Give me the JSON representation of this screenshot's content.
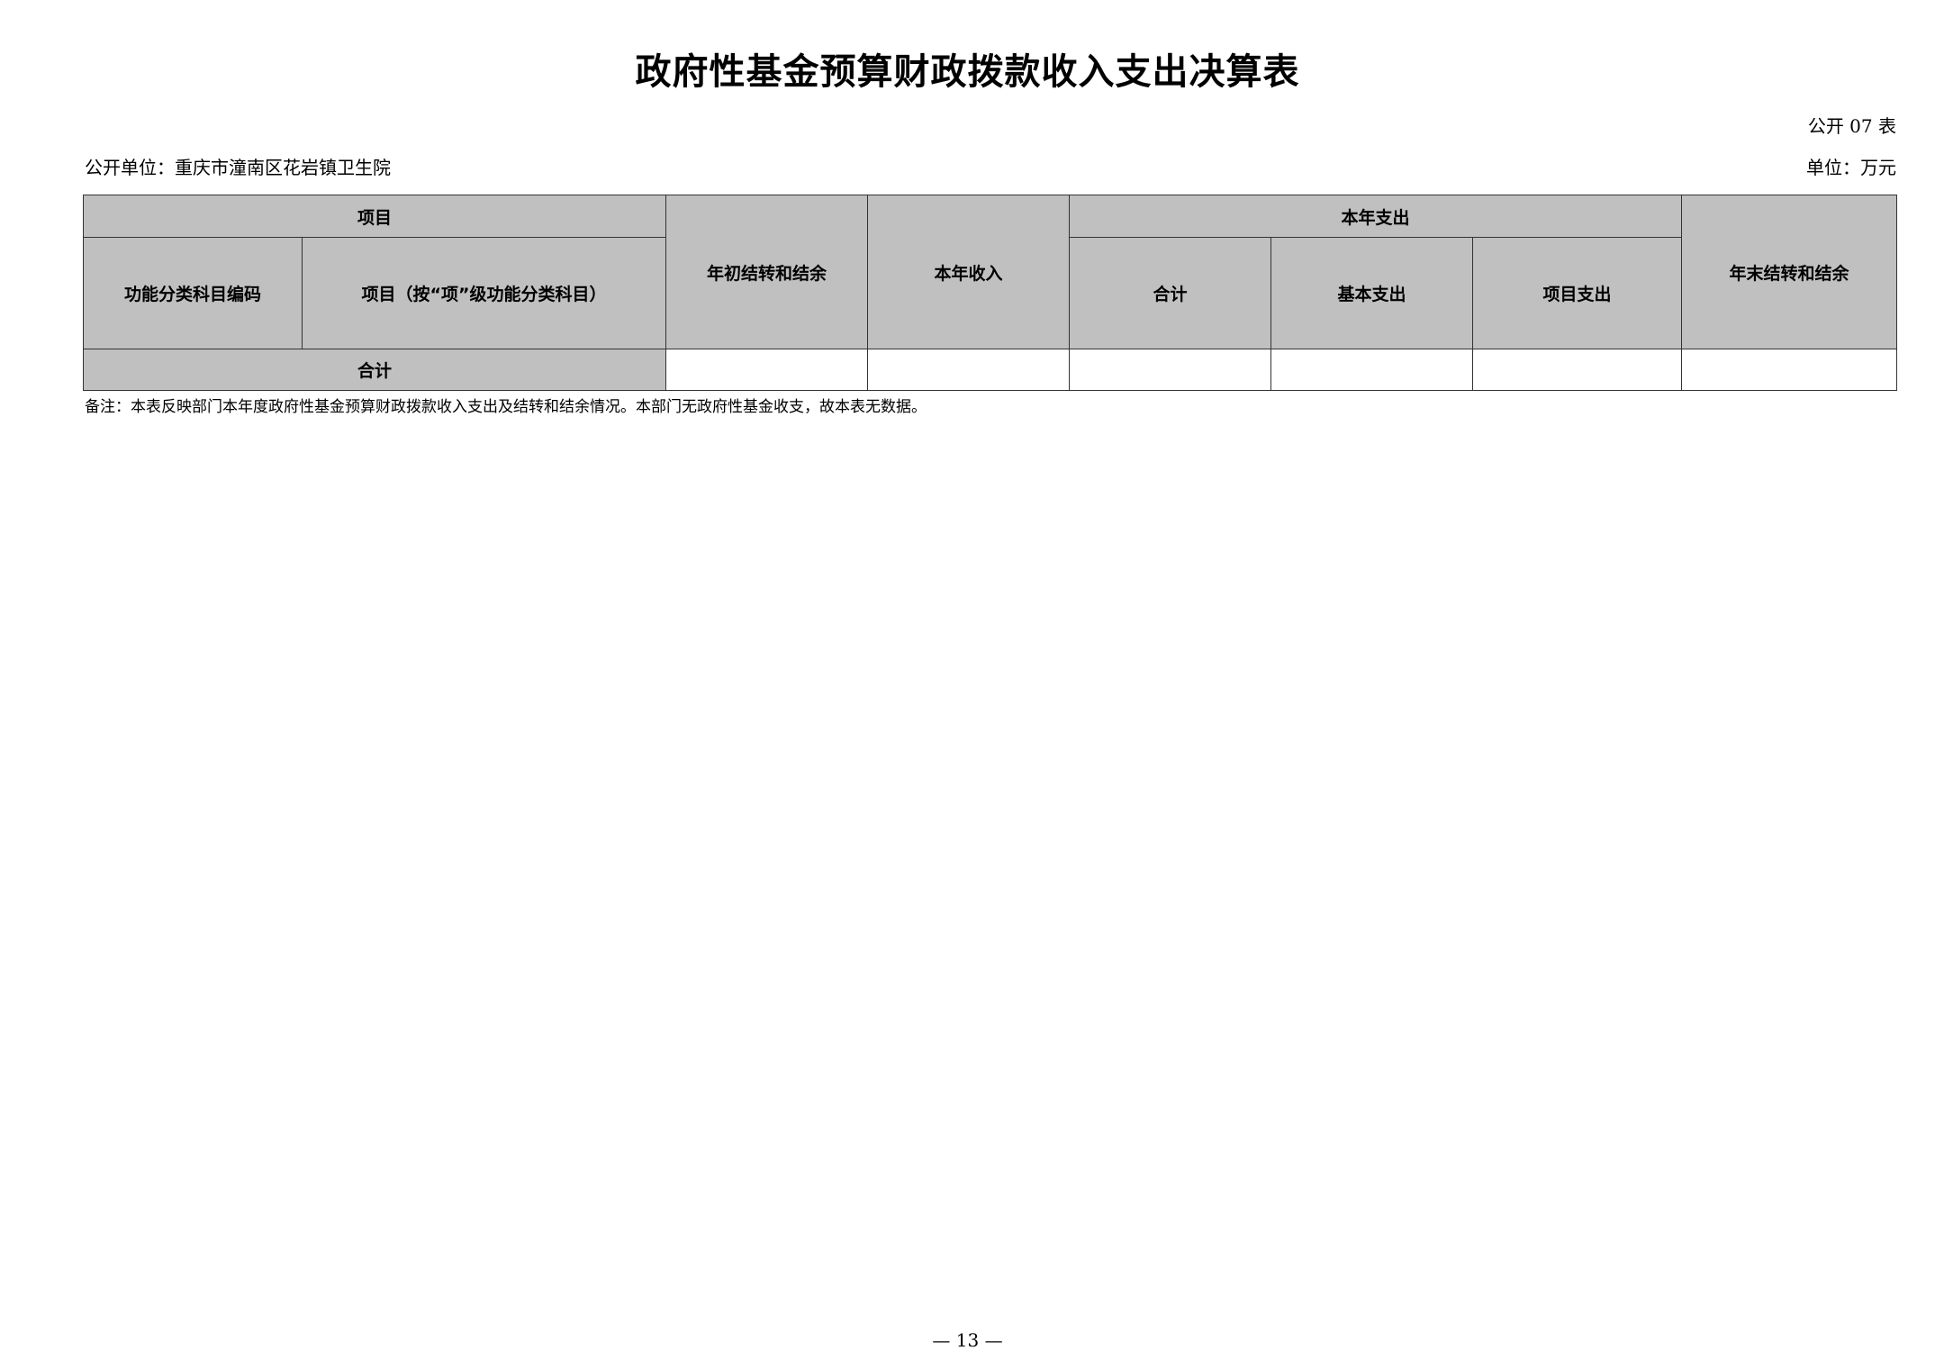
{
  "document": {
    "title": "政府性基金预算财政拨款收入支出决算表",
    "form_number": "公开 07 表",
    "reporting_unit": "公开单位：重庆市潼南区花岩镇卫生院",
    "currency_unit": "单位：万元",
    "note": "备注：本表反映部门本年度政府性基金预算财政拨款收入支出及结转和结余情况。本部门无政府性基金收支，故本表无数据。",
    "page_number": "— 13 —"
  },
  "table": {
    "headers": {
      "item": "项目",
      "function_code": "功能分类科目编码",
      "item_name": "项目（按“项”级功能分类科目）",
      "opening_balance": "年初结转和结余",
      "current_income": "本年收入",
      "current_expense": "本年支出",
      "expense_total": "合计",
      "basic_expense": "基本支出",
      "project_expense": "项目支出",
      "closing_balance": "年末结转和结余"
    },
    "total_row": {
      "label": "合计",
      "opening_balance": "",
      "current_income": "",
      "expense_total": "",
      "basic_expense": "",
      "project_expense": "",
      "closing_balance": ""
    }
  }
}
